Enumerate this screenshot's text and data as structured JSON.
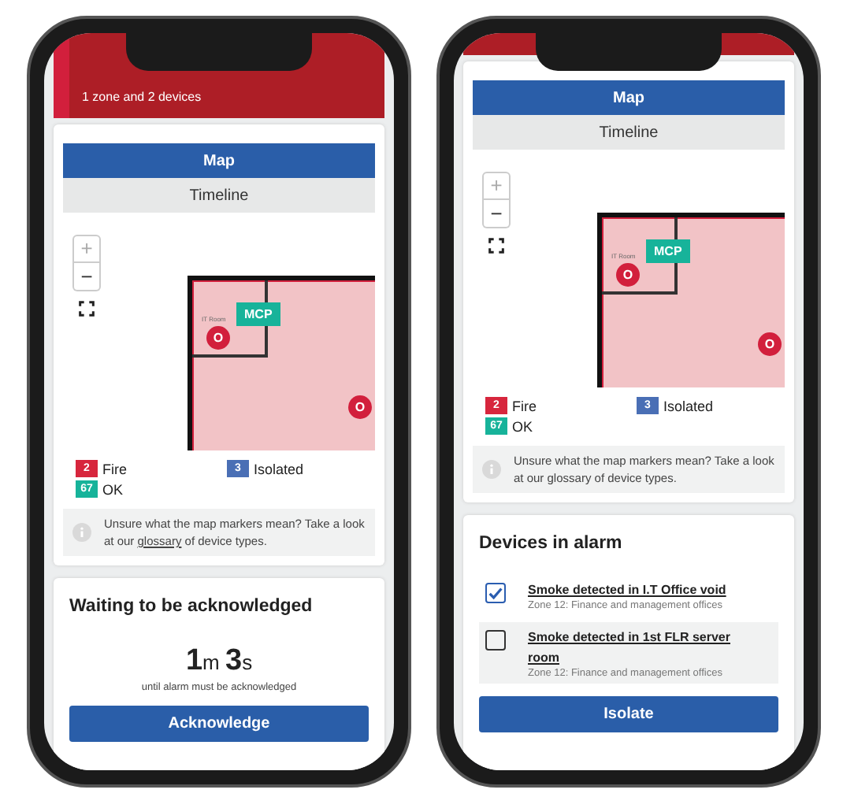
{
  "phones": [
    {
      "banner": {
        "kind": "full",
        "subtitle": "1 zone and 2 devices"
      },
      "tabs": [
        {
          "label": "Map",
          "selected": true
        },
        {
          "label": "Timeline",
          "selected": false
        }
      ],
      "map": {
        "zoom_in": "+",
        "zoom_out": "−",
        "room_label": "IT Room",
        "markers": [
          {
            "kind": "call-point",
            "label": "MCP"
          },
          {
            "kind": "fire",
            "label": "O"
          },
          {
            "kind": "fire",
            "label": "O"
          }
        ]
      },
      "legend": [
        {
          "count": "2",
          "label": "Fire",
          "color": "#d7263d"
        },
        {
          "count": "3",
          "label": "Isolated",
          "color": "#4a6fb5"
        },
        {
          "count": "67",
          "label": "OK",
          "color": "#17b39a"
        }
      ],
      "info": {
        "before": "Unsure what the map markers mean? Take a look at our ",
        "link": "glossary",
        "after": " of device types.",
        "link_underlined": true
      },
      "panel": {
        "kind": "acknowledge",
        "title": "Waiting to be acknowledged",
        "countdown": [
          {
            "value": "1",
            "unit": "m"
          },
          {
            "value": "3",
            "unit": "s"
          }
        ],
        "caption": "until alarm must be acknowledged",
        "button": "Acknowledge"
      }
    },
    {
      "banner": {
        "kind": "strip"
      },
      "tabs": [
        {
          "label": "Map",
          "selected": true
        },
        {
          "label": "Timeline",
          "selected": false
        }
      ],
      "map": {
        "zoom_in": "+",
        "zoom_out": "−",
        "room_label": "IT Room",
        "markers": [
          {
            "kind": "call-point",
            "label": "MCP"
          },
          {
            "kind": "fire",
            "label": "O"
          },
          {
            "kind": "fire",
            "label": "O"
          }
        ]
      },
      "legend": [
        {
          "count": "2",
          "label": "Fire",
          "color": "#d7263d"
        },
        {
          "count": "3",
          "label": "Isolated",
          "color": "#4a6fb5"
        },
        {
          "count": "67",
          "label": "OK",
          "color": "#17b39a"
        }
      ],
      "info": {
        "before": "Unsure what the map markers mean? Take a look at our ",
        "link": "glossary",
        "after": " of device types.",
        "link_underlined": false
      },
      "panel": {
        "kind": "devices",
        "title": "Devices in alarm",
        "devices": [
          {
            "title": "Smoke detected in I.T Office void",
            "zone": "Zone 12: Finance and management offices",
            "checked": true,
            "highlighted": false
          },
          {
            "title": "Smoke detected in 1st FLR server room",
            "zone": "Zone 12: Finance and management offices",
            "checked": false,
            "highlighted": true
          }
        ],
        "button": "Isolate"
      }
    }
  ]
}
